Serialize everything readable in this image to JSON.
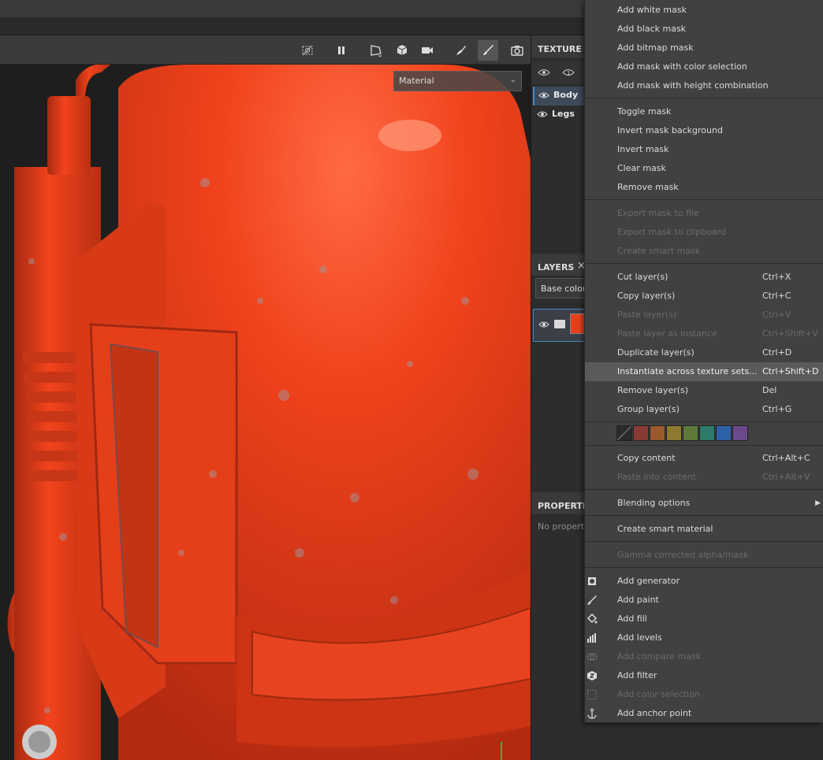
{
  "viewport": {
    "view_mode": "Material"
  },
  "toolbar_icons": [
    "hide-overlay-icon",
    "pause-icon",
    "camera-frame-icon",
    "cube-icon",
    "video-camera-icon",
    "brush-stroke-icon",
    "paintbrush-icon",
    "screenshot-camera-icon"
  ],
  "texture_set_panel": {
    "title": "TEXTURE S",
    "sets": [
      {
        "name": "Body",
        "selected": true
      },
      {
        "name": "Legs",
        "selected": false
      }
    ]
  },
  "layers_panel": {
    "title": "LAYERS",
    "close": "×",
    "channel": "Base color"
  },
  "properties_panel": {
    "title": "PROPERTIE",
    "empty_text": "No properti"
  },
  "context_menu": {
    "mask_items": [
      {
        "label": "Add white mask",
        "enabled": true
      },
      {
        "label": "Add black mask",
        "enabled": true
      },
      {
        "label": "Add bitmap mask",
        "enabled": true
      },
      {
        "label": "Add mask with color selection",
        "enabled": true
      },
      {
        "label": "Add mask with height combination",
        "enabled": true
      }
    ],
    "mask_ops": [
      {
        "label": "Toggle mask",
        "enabled": true
      },
      {
        "label": "Invert mask background",
        "enabled": true
      },
      {
        "label": "Invert mask",
        "enabled": true
      },
      {
        "label": "Clear mask",
        "enabled": true
      },
      {
        "label": "Remove mask",
        "enabled": true
      }
    ],
    "mask_export": [
      {
        "label": "Export mask to file",
        "enabled": false
      },
      {
        "label": "Export mask to clipboard",
        "enabled": false
      },
      {
        "label": "Create smart mask",
        "enabled": false
      }
    ],
    "layer_ops": [
      {
        "label": "Cut layer(s)",
        "shortcut": "Ctrl+X",
        "enabled": true
      },
      {
        "label": "Copy layer(s)",
        "shortcut": "Ctrl+C",
        "enabled": true
      },
      {
        "label": "Paste layer(s)",
        "shortcut": "Ctrl+V",
        "enabled": false
      },
      {
        "label": "Paste layer as instance",
        "shortcut": "Ctrl+Shift+V",
        "enabled": false
      },
      {
        "label": "Duplicate layer(s)",
        "shortcut": "Ctrl+D",
        "enabled": true
      },
      {
        "label": "Instantiate across texture sets...",
        "shortcut": "Ctrl+Shift+D",
        "enabled": true,
        "highlighted": true
      },
      {
        "label": "Remove layer(s)",
        "shortcut": "Del",
        "enabled": true
      },
      {
        "label": "Group layer(s)",
        "shortcut": "Ctrl+G",
        "enabled": true
      }
    ],
    "color_tags": [
      "none",
      "#8a3a34",
      "#9a5a2e",
      "#8e7a2e",
      "#5e7a3a",
      "#2e7a6a",
      "#2e62a8",
      "#6a4a8a"
    ],
    "content_ops": [
      {
        "label": "Copy content",
        "shortcut": "Ctrl+Alt+C",
        "enabled": true
      },
      {
        "label": "Paste into content",
        "shortcut": "Ctrl+Alt+V",
        "enabled": false
      }
    ],
    "blending": {
      "label": "Blending options",
      "submenu": true
    },
    "smart_material": {
      "label": "Create smart material"
    },
    "gamma": {
      "label": "Gamma corrected alpha/mask",
      "enabled": false
    },
    "add_effects": [
      {
        "label": "Add generator",
        "icon": "generator-icon",
        "enabled": true
      },
      {
        "label": "Add paint",
        "icon": "paint-brush-icon",
        "enabled": true
      },
      {
        "label": "Add fill",
        "icon": "fill-bucket-icon",
        "enabled": true
      },
      {
        "label": "Add levels",
        "icon": "levels-icon",
        "enabled": true
      },
      {
        "label": "Add compare mask",
        "icon": "compare-mask-icon",
        "enabled": false
      },
      {
        "label": "Add filter",
        "icon": "filter-icon",
        "enabled": true
      },
      {
        "label": "Add color selection",
        "icon": "color-selection-icon",
        "enabled": false
      },
      {
        "label": "Add anchor point",
        "icon": "anchor-icon",
        "enabled": true
      }
    ]
  }
}
